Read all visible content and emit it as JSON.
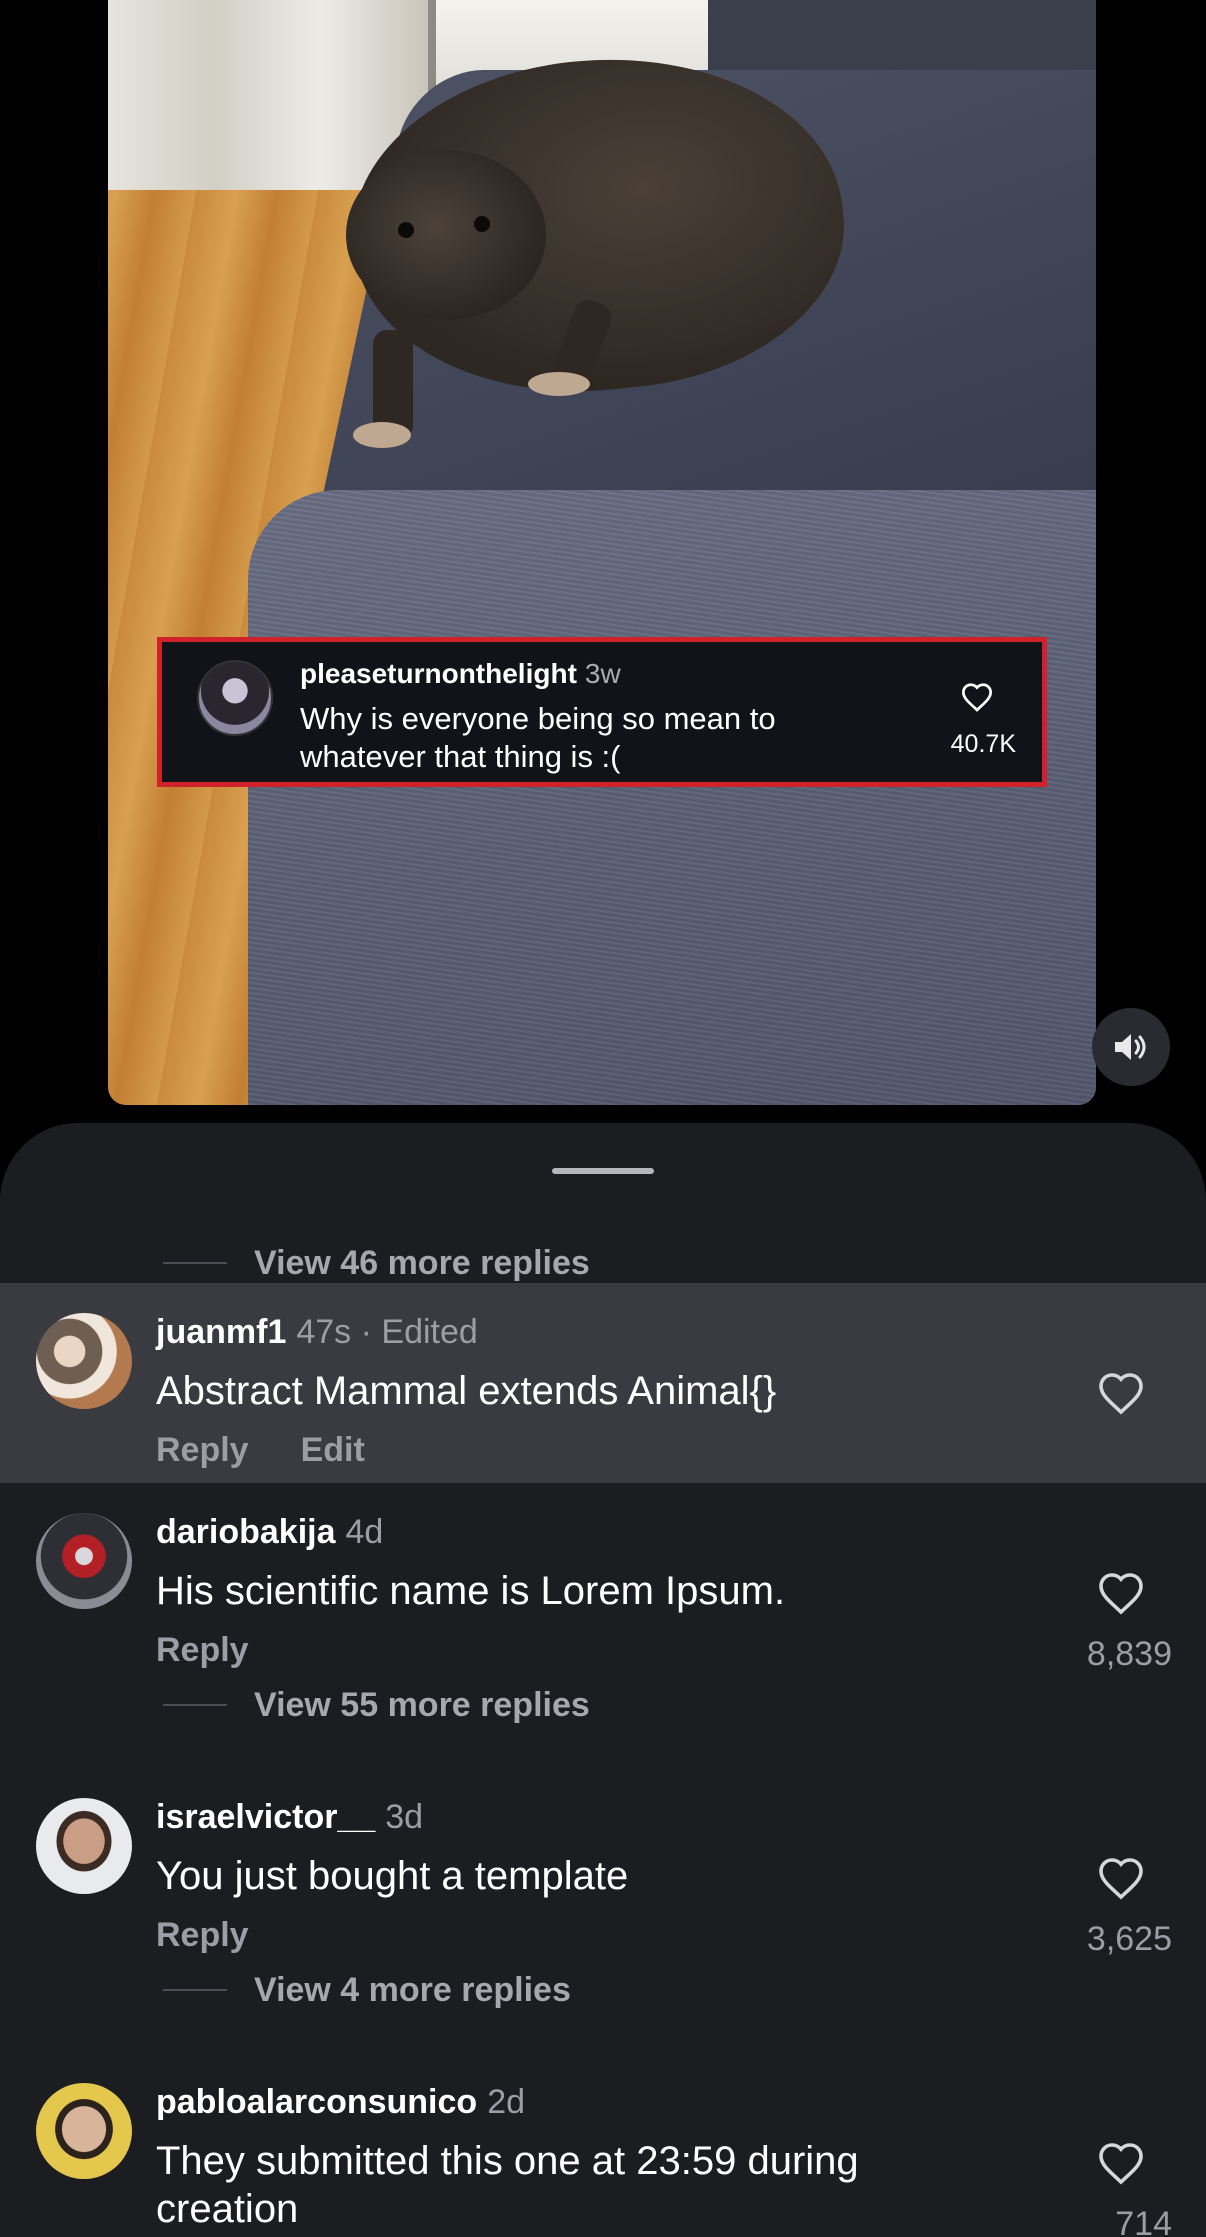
{
  "overlay_comment": {
    "username": "pleaseturnonthelight",
    "time": "3w",
    "text": "Why is everyone being so mean to whatever that thing is :(",
    "likes": "40.7K"
  },
  "sheet": {
    "top_more_replies": "View 46 more replies"
  },
  "comments": [
    {
      "username": "juanmf1",
      "meta": "47s · Edited",
      "text": "Abstract Mammal extends Animal{}",
      "actions": [
        "Reply",
        "Edit"
      ],
      "likes": ""
    },
    {
      "username": "dariobakija",
      "meta": "4d",
      "text": "His scientific name is Lorem Ipsum.",
      "actions": [
        "Reply"
      ],
      "likes": "8,839",
      "more_replies": "View 55 more replies"
    },
    {
      "username": "israelvictor__",
      "meta": "3d",
      "text": "You just bought a template",
      "actions": [
        "Reply"
      ],
      "likes": "3,625",
      "more_replies": "View 4 more replies"
    },
    {
      "username": "pabloalarconsunico",
      "meta": "2d",
      "text": "They submitted this one at 23:59 during creation",
      "actions": [],
      "likes": "714"
    }
  ],
  "icons": {
    "heart": "heart-outline-icon",
    "sound": "speaker-on-icon"
  },
  "colors": {
    "highlight_border": "#d1222c",
    "sheet_bg": "#1c1d21",
    "highlighted_row_bg": "#3a3b40"
  }
}
